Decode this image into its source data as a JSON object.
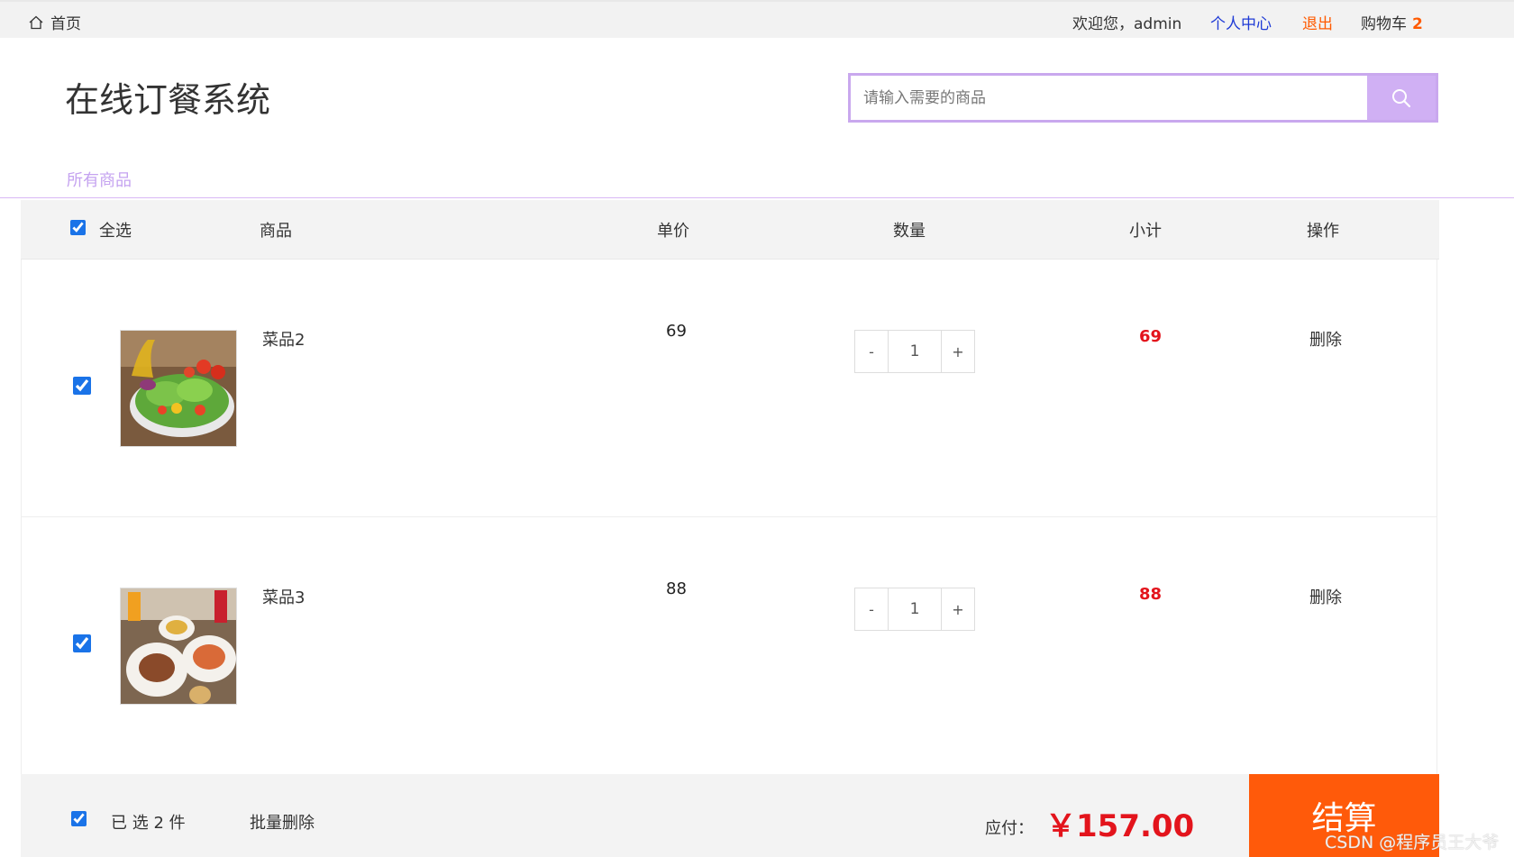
{
  "topbar": {
    "home_label": "首页",
    "welcome": "欢迎您，admin",
    "personal_center": "个人中心",
    "logout": "退出",
    "cart_label": "购物车",
    "cart_count": "2"
  },
  "header": {
    "logo": "在线订餐系统",
    "search_placeholder": "请输入需要的商品",
    "nav_all": "所有商品"
  },
  "table": {
    "select_all": "全选",
    "columns": {
      "product": "商品",
      "price": "单价",
      "quantity": "数量",
      "subtotal": "小计",
      "action": "操作"
    },
    "rows": [
      {
        "name": "菜品2",
        "price": "69",
        "quantity": "1",
        "subtotal": "69",
        "action": "删除",
        "checked": true,
        "image": "salad-image"
      },
      {
        "name": "菜品3",
        "price": "88",
        "quantity": "1",
        "subtotal": "88",
        "action": "删除",
        "checked": true,
        "image": "meal-image"
      }
    ],
    "qty_minus": "-",
    "qty_plus": "+"
  },
  "footer": {
    "selected_text": "已 选 2 件",
    "batch_delete": "批量删除",
    "pay_label": "应付：",
    "pay_amount": "￥157.00",
    "checkout": "结算"
  },
  "watermark": "CSDN @程序员王大爷",
  "colors": {
    "accent": "#c9a8ee",
    "orange": "#ff5a0a",
    "red": "#e3141c",
    "link_blue": "#1f3bd6"
  }
}
